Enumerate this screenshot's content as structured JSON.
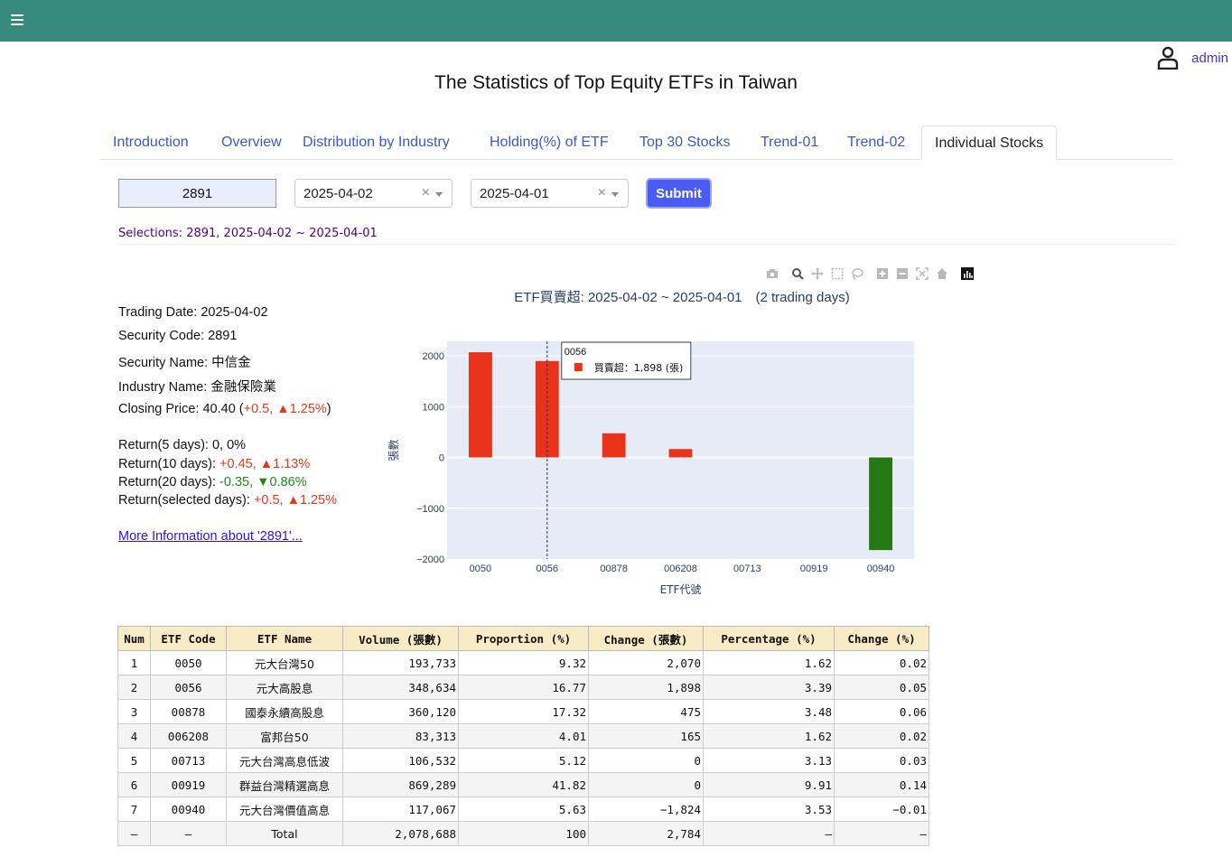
{
  "header": {
    "menu_icon": "hamburger-icon",
    "user_icon": "user-icon",
    "username": "admin"
  },
  "title": "The Statistics of Top Equity ETFs in Taiwan",
  "tabs": [
    {
      "label": "Introduction"
    },
    {
      "label": "Overview"
    },
    {
      "label": "Distribution by Industry"
    },
    {
      "label": "Holding(%) of ETF"
    },
    {
      "label": "Top 30 Stocks"
    },
    {
      "label": "Trend-01"
    },
    {
      "label": "Trend-02"
    },
    {
      "label": "Individual Stocks",
      "active": true
    }
  ],
  "controls": {
    "stock_code": "2891",
    "date_start": "2025-04-02",
    "date_end": "2025-04-01",
    "submit_label": "Submit"
  },
  "selections_text": "Selections: 2891, 2025-04-02 ~ 2025-04-01",
  "info": {
    "trading_date": "Trading Date: 2025-04-02",
    "security_code": "Security Code: 2891",
    "security_name": "Security Name: 中信金",
    "industry_name": "Industry Name: 金融保險業",
    "closing_label": "Closing Price: 40.40 (",
    "closing_change": "+0.5, ▲1.25%",
    "closing_end": ")",
    "ret5_label": "Return(5 days): ",
    "ret5_value": "0, 0%",
    "ret10_label": "Return(10 days): ",
    "ret10_value": "+0.45, ▲1.13%",
    "ret20_label": "Return(20 days): ",
    "ret20_value": "-0.35, ▼0.86%",
    "retsel_label": "Return(selected days): ",
    "retsel_value": "+0.5, ▲1.25%",
    "more_link": "More Information about '2891'..."
  },
  "modebar_icons": [
    "camera-icon",
    "zoom-icon",
    "pan-icon",
    "box-select-icon",
    "lasso-select-icon",
    "zoom-in-icon",
    "zoom-out-icon",
    "autoscale-icon",
    "reset-axes-icon",
    "plotly-logo-icon"
  ],
  "chart_data": {
    "type": "bar",
    "title": "ETF買賣超: 2025-04-02 ~ 2025-04-01　(2 trading days)",
    "xlabel": "ETF代號",
    "ylabel": "張數",
    "categories": [
      "0050",
      "0056",
      "00878",
      "006208",
      "00713",
      "00919",
      "00940"
    ],
    "values": [
      2070,
      1898,
      475,
      165,
      0,
      0,
      -1824
    ],
    "ylim": [
      -2000,
      2000
    ],
    "yticks": [
      2000,
      1000,
      0,
      -1000,
      -2000
    ],
    "ytick_labels": [
      "2000",
      "1000",
      "0",
      "−1000",
      "−2000"
    ],
    "colors": {
      "positive": "#e8321a",
      "negative": "#237a14",
      "plot_bg": "#e5ecf6",
      "grid": "#ffffff"
    },
    "hover": {
      "category": "0056",
      "title": "0056",
      "label": "買賣超：1,898 (張)"
    }
  },
  "table": {
    "headers": [
      "Num",
      "ETF Code",
      "ETF Name",
      "Volume (張數)",
      "Proportion (%)",
      "Change (張數)",
      "Percentage (%)",
      "Change (%)"
    ],
    "rows": [
      [
        "1",
        "0050",
        "元大台灣50",
        "193,733",
        "9.32",
        "2,070",
        "1.62",
        "0.02"
      ],
      [
        "2",
        "0056",
        "元大高股息",
        "348,634",
        "16.77",
        "1,898",
        "3.39",
        "0.05"
      ],
      [
        "3",
        "00878",
        "國泰永續高股息",
        "360,120",
        "17.32",
        "475",
        "3.48",
        "0.06"
      ],
      [
        "4",
        "006208",
        "富邦台50",
        "83,313",
        "4.01",
        "165",
        "1.62",
        "0.02"
      ],
      [
        "5",
        "00713",
        "元大台灣高息低波",
        "106,532",
        "5.12",
        "0",
        "3.13",
        "0.03"
      ],
      [
        "6",
        "00919",
        "群益台灣精選高息",
        "869,289",
        "41.82",
        "0",
        "9.91",
        "0.14"
      ],
      [
        "7",
        "00940",
        "元大台灣價值高息",
        "117,067",
        "5.63",
        "−1,824",
        "3.53",
        "−0.01"
      ],
      [
        "–",
        "–",
        "Total",
        "2,078,688",
        "100",
        "2,784",
        "–",
        "–"
      ]
    ]
  }
}
